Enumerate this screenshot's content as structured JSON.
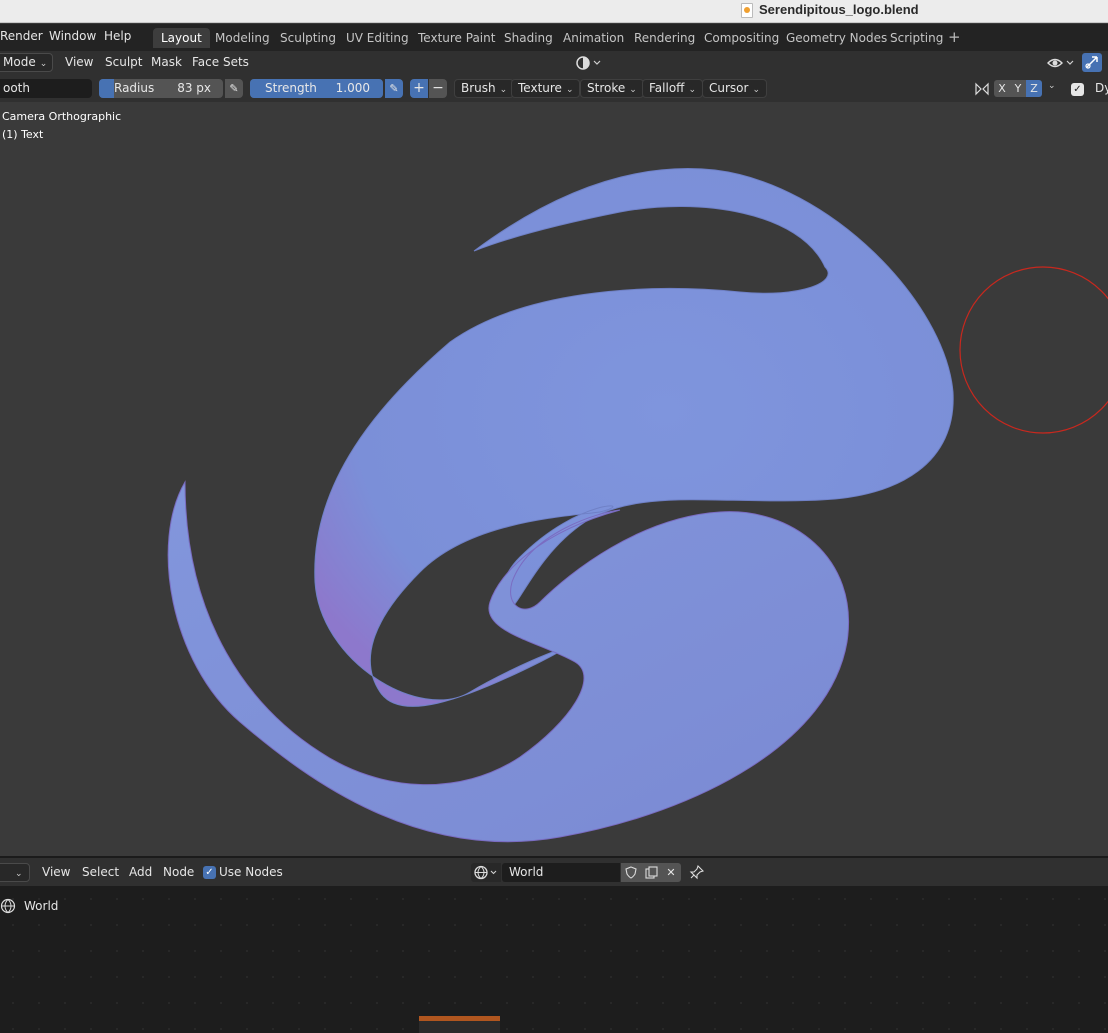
{
  "window": {
    "title": "Serendipitous_logo.blend"
  },
  "menubar": {
    "items": [
      "Render",
      "Window",
      "Help"
    ]
  },
  "workspaces": {
    "tabs": [
      "Layout",
      "Modeling",
      "Sculpting",
      "UV Editing",
      "Texture Paint",
      "Shading",
      "Animation",
      "Rendering",
      "Compositing",
      "Geometry Nodes",
      "Scripting"
    ],
    "active": "Layout",
    "add_symbol": "+"
  },
  "header": {
    "mode_label": "Mode",
    "menus": [
      "View",
      "Sculpt",
      "Mask",
      "Face Sets"
    ]
  },
  "tool_settings": {
    "brush_name": "ooth",
    "radius": {
      "label": "Radius",
      "value": "83 px",
      "fraction": 0.12
    },
    "strength": {
      "label": "Strength",
      "value": "1.000",
      "fraction": 1.0
    },
    "plus_symbol": "+",
    "minus_symbol": "−",
    "dropdowns": [
      "Brush",
      "Texture",
      "Stroke",
      "Falloff",
      "Cursor"
    ],
    "axes": [
      "X",
      "Y",
      "Z"
    ],
    "active_axis": "Z",
    "dyntopo_label": "Dy"
  },
  "viewport": {
    "view_name": "Camera Orthographic",
    "object_label": "(1) Text",
    "colors": {
      "background": "#3a3a3a",
      "mesh": "#7e93db",
      "mesh_shadow": "#9a6ac0",
      "brush_cursor": "#c8281e"
    }
  },
  "node_editor": {
    "menus": [
      "View",
      "Select",
      "Add",
      "Node"
    ],
    "use_nodes_label": "Use Nodes",
    "use_nodes_checked": true,
    "world_name": "World",
    "breadcrumb": "World"
  },
  "icons": [
    "document-icon",
    "viewport-shading-icon",
    "visibility-icon",
    "gizmo-icon",
    "pen-pressure-icon",
    "symmetry-icon",
    "world-icon",
    "fake-user-shield-icon",
    "duplicate-icon",
    "close-icon",
    "pin-icon"
  ]
}
